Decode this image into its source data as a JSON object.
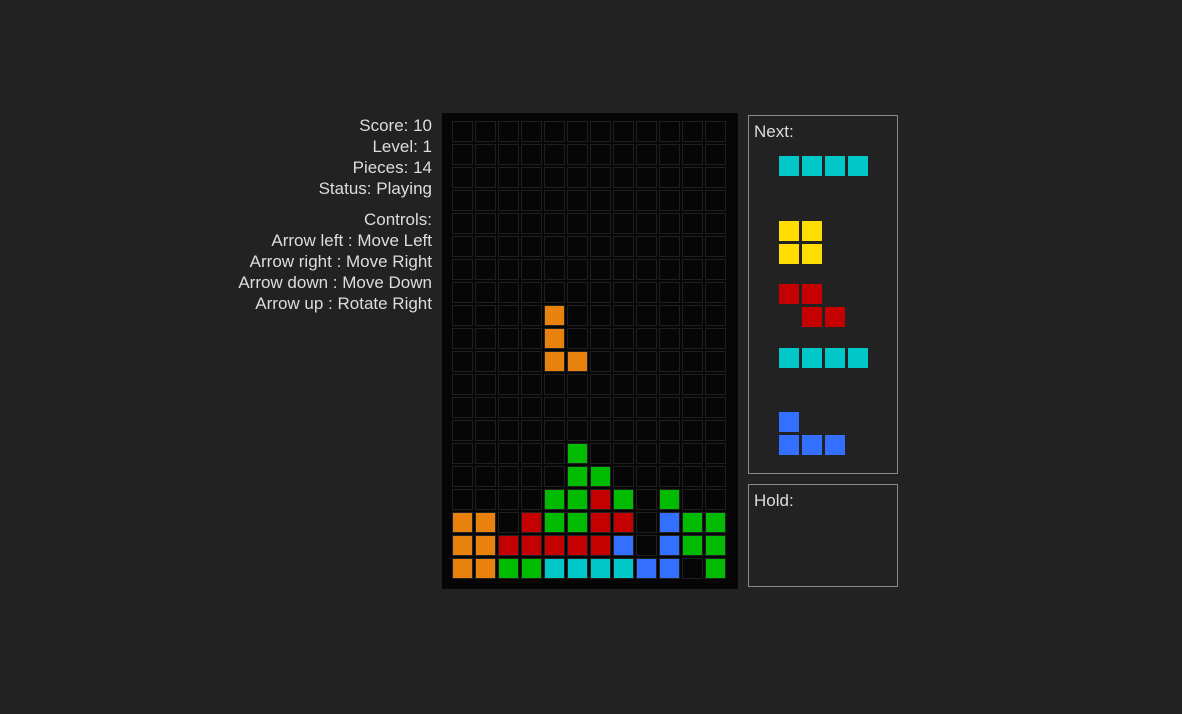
{
  "stats": {
    "score": "Score: 10",
    "level": "Level: 1",
    "pieces": "Pieces: 14",
    "status": "Status: Playing"
  },
  "controls": {
    "title": "Controls:",
    "items": [
      "Arrow left : Move Left",
      "Arrow right : Move Right",
      "Arrow down : Move Down",
      "Arrow up : Rotate Right"
    ]
  },
  "colors": {
    "O": "#e8820c",
    "G": "#00bb00",
    "R": "#c40000",
    "B": "#3370ff",
    "C": "#00c8c8",
    "Y": "#ffdd00",
    "empty": "#060606"
  },
  "board": {
    "columns": 12,
    "rows": 20,
    "grid": [
      "............",
      "............",
      "............",
      "............",
      "............",
      "............",
      "............",
      "............",
      "............",
      "............",
      "............",
      "............",
      "............",
      "............",
      "............",
      "............",
      "............",
      "............",
      "............",
      "............"
    ],
    "stack": [
      ".....G......",
      ".....GG.....",
      "....GGRG.G..",
      "OO.RGGRR.BGG",
      "OORRRRRB.BGG",
      "OOGGCCCCBB.G"
    ],
    "active_piece": {
      "name": "L",
      "color": "O",
      "cells": [
        [
          4,
          8
        ],
        [
          4,
          9
        ],
        [
          4,
          10
        ],
        [
          5,
          10
        ]
      ]
    }
  },
  "next_panel": {
    "title": "Next:",
    "pieces": [
      {
        "name": "I",
        "color": "C",
        "shape": [
          "####"
        ]
      },
      {
        "name": "O",
        "color": "Y",
        "shape": [
          "##",
          "##"
        ]
      },
      {
        "name": "Z",
        "color": "R",
        "shape": [
          "##.",
          ".##"
        ]
      },
      {
        "name": "I",
        "color": "C",
        "shape": [
          "####"
        ]
      },
      {
        "name": "J",
        "color": "B",
        "shape": [
          "#..",
          "###"
        ]
      }
    ]
  },
  "hold_panel": {
    "title": "Hold:",
    "piece": null
  }
}
